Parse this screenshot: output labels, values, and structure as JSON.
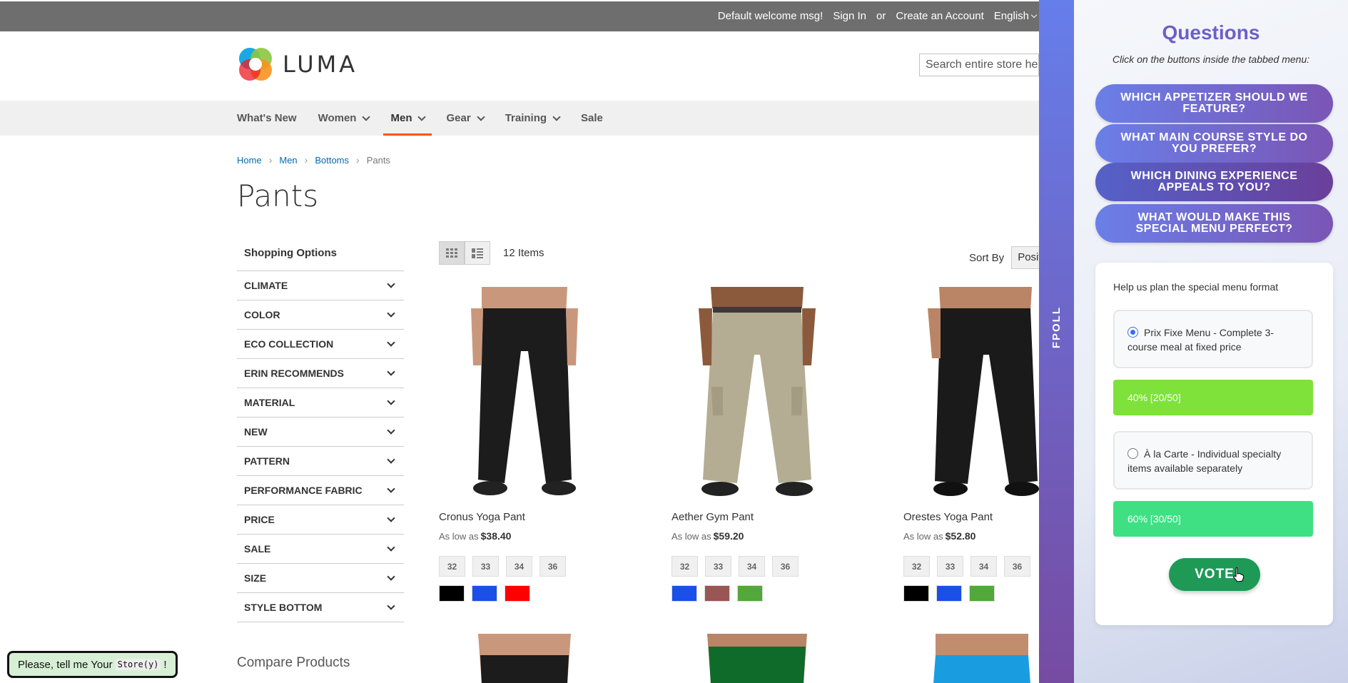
{
  "topbar": {
    "welcome": "Default welcome msg!",
    "sign_in": "Sign In",
    "or": "or",
    "create_account": "Create an Account",
    "language": "English"
  },
  "header": {
    "logo_text": "LUMA",
    "search_placeholder": "Search entire store here..."
  },
  "nav": {
    "items": [
      {
        "label": "What's New"
      },
      {
        "label": "Women"
      },
      {
        "label": "Men"
      },
      {
        "label": "Gear"
      },
      {
        "label": "Training"
      },
      {
        "label": "Sale"
      }
    ]
  },
  "breadcrumb": {
    "items": [
      "Home",
      "Men",
      "Bottoms"
    ],
    "current": "Pants"
  },
  "page_title": "Pants",
  "filters": {
    "title": "Shopping Options",
    "items": [
      "CLIMATE",
      "COLOR",
      "ECO COLLECTION",
      "ERIN RECOMMENDS",
      "MATERIAL",
      "NEW",
      "PATTERN",
      "PERFORMANCE FABRIC",
      "PRICE",
      "SALE",
      "SIZE",
      "STYLE BOTTOM"
    ],
    "compare_title": "Compare Products"
  },
  "toolbar": {
    "items_count": "12 Items",
    "sort_label": "Sort By",
    "sort_value": "Position"
  },
  "products": [
    {
      "name": "Cronus Yoga Pant",
      "price_prefix": "As low as",
      "price": "$38.40",
      "sizes": [
        "32",
        "33",
        "34",
        "36"
      ],
      "colors": [
        "#000000",
        "#1a4fe8",
        "#ff0000"
      ]
    },
    {
      "name": "Aether Gym Pant",
      "price_prefix": "As low as",
      "price": "$59.20",
      "sizes": [
        "32",
        "33",
        "34",
        "36"
      ],
      "colors": [
        "#1a4fe8",
        "#9a5555",
        "#52a83a"
      ]
    },
    {
      "name": "Orestes Yoga Pant",
      "price_prefix": "As low as",
      "price": "$52.80",
      "sizes": [
        "32",
        "33",
        "34",
        "36"
      ],
      "colors": [
        "#000000",
        "#1a4fe8",
        "#52a83a"
      ]
    }
  ],
  "store_tip": {
    "text": "Please, tell me Your",
    "code": "Store(y)",
    "suffix": "!"
  },
  "poll": {
    "tab_label": "FPOLL",
    "title": "Questions",
    "subtitle": "Click on the buttons inside the tabbed menu:",
    "questions": [
      "Which appetizer should we feature?",
      "What main course style do you prefer?",
      "Which dining experience appeals to you?",
      "What would make this special menu perfect?"
    ],
    "card": {
      "question": "Help us plan the special menu format",
      "options": [
        {
          "label": "Prix Fixe Menu - Complete 3-course meal at fixed price",
          "result": "40% [20/50]",
          "percent": 40,
          "color": "#7ee23a"
        },
        {
          "label": "À la Carte - Individual specialty items available separately",
          "result": "60% [30/50]",
          "percent": 60,
          "color": "#3ee083"
        }
      ],
      "vote_label": "VOTE"
    }
  }
}
